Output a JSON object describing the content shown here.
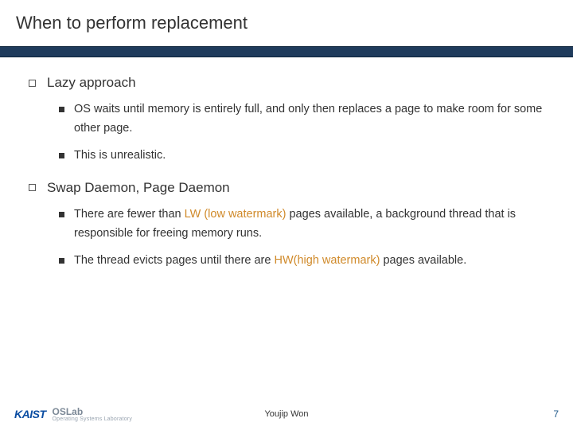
{
  "title": "When to perform replacement",
  "sections": [
    {
      "heading": "Lazy approach",
      "items": [
        {
          "pre": "OS waits until memory is entirely full, and only then replaces a page to make room for some other page."
        },
        {
          "pre": "This is unrealistic."
        }
      ]
    },
    {
      "heading": "Swap Daemon, Page Daemon",
      "items": [
        {
          "pre": "There are fewer than ",
          "hl": "LW (low watermark)",
          "post": " pages available, a background thread that is responsible for freeing memory runs."
        },
        {
          "pre": "The thread evicts pages until there are ",
          "hl": "HW(high watermark)",
          "post": " pages available."
        }
      ]
    }
  ],
  "footer": {
    "org1": "KAIST",
    "org2": "OSLab",
    "org2_sub": "Operating Systems Laboratory",
    "author": "Youjip Won",
    "page": "7"
  }
}
